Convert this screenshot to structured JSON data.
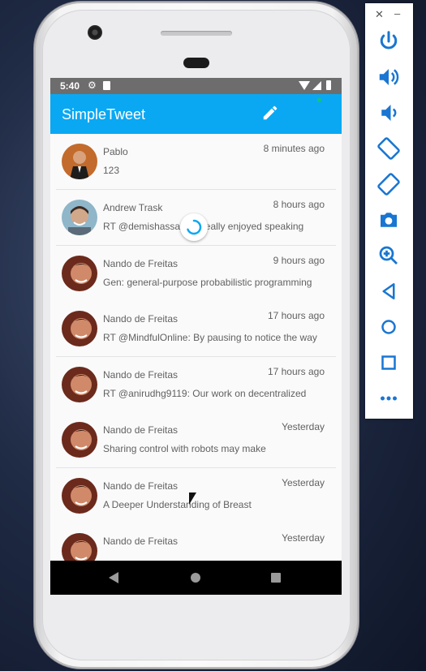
{
  "status": {
    "time": "5:40"
  },
  "toolbar": {
    "title": "SimpleTweet"
  },
  "tweets": [
    {
      "name": "Pablo",
      "time": "8 minutes ago",
      "text": "123"
    },
    {
      "name": "Andrew Trask",
      "time": "8 hours ago",
      "text": "RT @demishassabis: Really enjoyed speaking"
    },
    {
      "name": "Nando de Freitas",
      "time": "9 hours ago",
      "text": "Gen: general-purpose probabilistic programming"
    },
    {
      "name": "Nando de Freitas",
      "time": "17 hours ago",
      "text": "RT @MindfulOnline: By pausing to notice the way"
    },
    {
      "name": "Nando de Freitas",
      "time": "17 hours ago",
      "text": "RT @anirudhg9119: Our work on decentralized"
    },
    {
      "name": "Nando de Freitas",
      "time": "Yesterday",
      "text": "Sharing control with robots may make"
    },
    {
      "name": "Nando de Freitas",
      "time": "Yesterday",
      "text": "A Deeper Understanding of Breast"
    },
    {
      "name": "Nando de Freitas",
      "time": "Yesterday",
      "text": ""
    }
  ],
  "colors": {
    "toolbar": "#0aa8f3",
    "statusbar": "#6d6d6d",
    "spinner": "#0aa8f3"
  },
  "icons": {
    "toolbar": "pencil-icon",
    "side_panel": [
      "close-icon",
      "minimize-icon",
      "power-icon",
      "volume-up-icon",
      "volume-down-icon",
      "rotate-left-icon",
      "rotate-right-icon",
      "camera-icon",
      "zoom-icon",
      "back-icon",
      "home-icon",
      "overview-icon",
      "more-icon"
    ]
  }
}
